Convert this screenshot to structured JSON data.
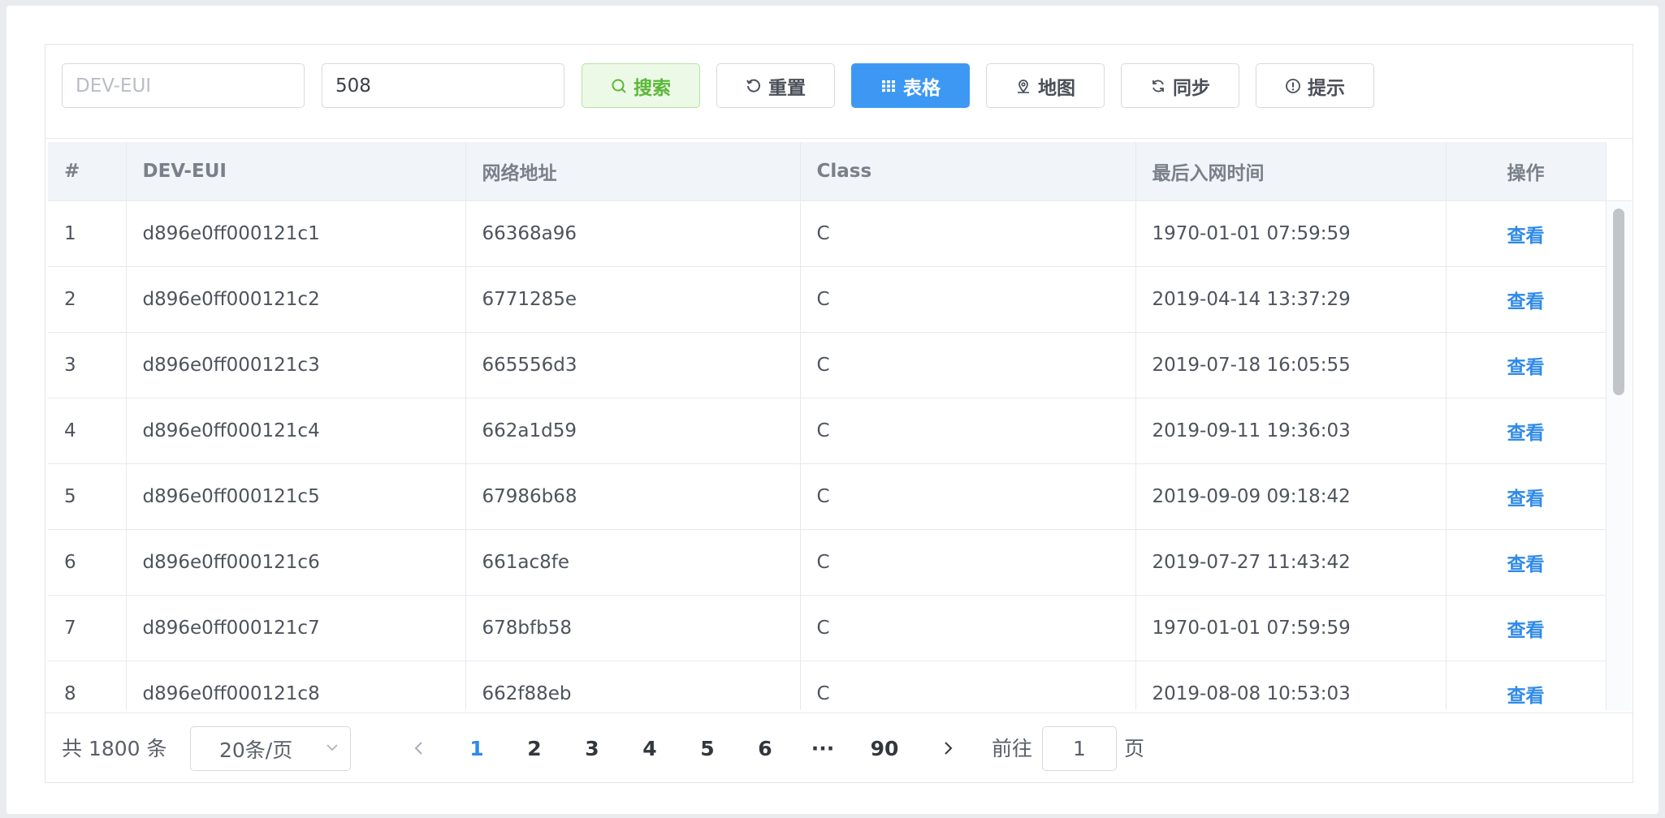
{
  "search": {
    "dev_eui_placeholder": "DEV-EUI",
    "second_value": "508"
  },
  "toolbar": {
    "search_label": "搜索",
    "reset_label": "重置",
    "table_label": "表格",
    "map_label": "地图",
    "sync_label": "同步",
    "tip_label": "提示"
  },
  "table": {
    "headers": [
      "#",
      "DEV-EUI",
      "网络地址",
      "Class",
      "最后入网时间",
      "操作"
    ],
    "rows": [
      {
        "idx": "1",
        "dev_eui": "d896e0ff000121c1",
        "addr": "66368a96",
        "cls": "C",
        "time": "1970-01-01 07:59:59",
        "op": "查看"
      },
      {
        "idx": "2",
        "dev_eui": "d896e0ff000121c2",
        "addr": "6771285e",
        "cls": "C",
        "time": "2019-04-14 13:37:29",
        "op": "查看"
      },
      {
        "idx": "3",
        "dev_eui": "d896e0ff000121c3",
        "addr": "665556d3",
        "cls": "C",
        "time": "2019-07-18 16:05:55",
        "op": "查看"
      },
      {
        "idx": "4",
        "dev_eui": "d896e0ff000121c4",
        "addr": "662a1d59",
        "cls": "C",
        "time": "2019-09-11 19:36:03",
        "op": "查看"
      },
      {
        "idx": "5",
        "dev_eui": "d896e0ff000121c5",
        "addr": "67986b68",
        "cls": "C",
        "time": "2019-09-09 09:18:42",
        "op": "查看"
      },
      {
        "idx": "6",
        "dev_eui": "d896e0ff000121c6",
        "addr": "661ac8fe",
        "cls": "C",
        "time": "2019-07-27 11:43:42",
        "op": "查看"
      },
      {
        "idx": "7",
        "dev_eui": "d896e0ff000121c7",
        "addr": "678bfb58",
        "cls": "C",
        "time": "1970-01-01 07:59:59",
        "op": "查看"
      },
      {
        "idx": "8",
        "dev_eui": "d896e0ff000121c8",
        "addr": "662f88eb",
        "cls": "C",
        "time": "2019-08-08 10:53:03",
        "op": "查看"
      }
    ]
  },
  "pagination": {
    "total_text": "共 1800 条",
    "page_size": "20条/页",
    "pages": [
      "1",
      "2",
      "3",
      "4",
      "5",
      "6"
    ],
    "ellipsis": "···",
    "last_page": "90",
    "current_page": "1",
    "goto_prefix": "前往",
    "goto_value": "1",
    "goto_suffix": "页"
  },
  "colors": {
    "primary": "#3d98f4",
    "link": "#2f8ae8",
    "success_bg": "#edf9e7",
    "success_text": "#5ab838"
  }
}
